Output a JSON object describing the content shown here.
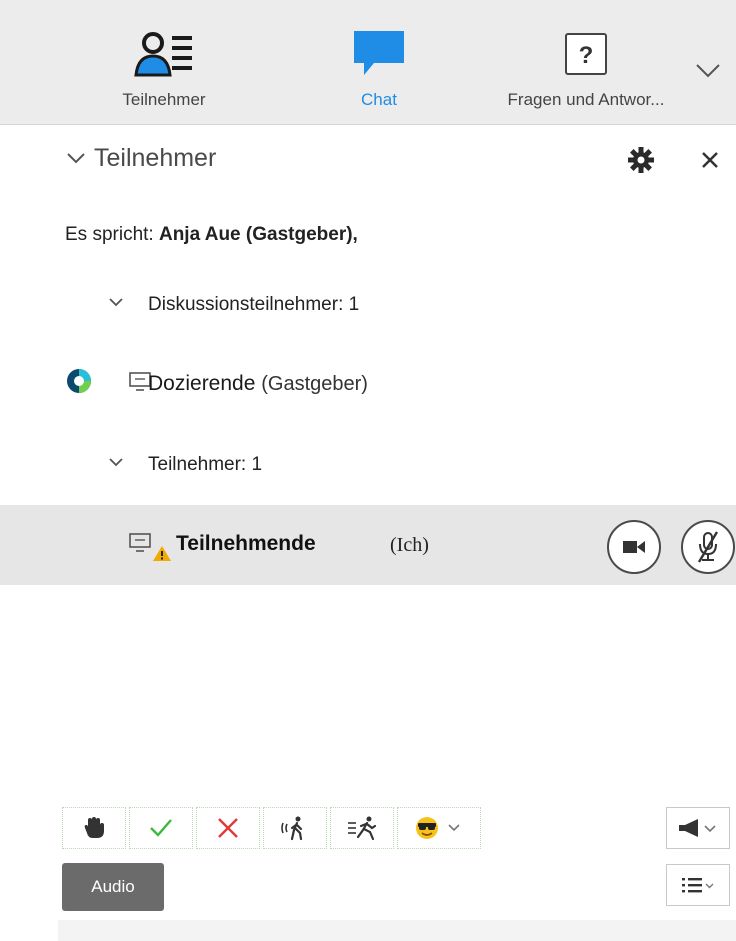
{
  "tabs": [
    {
      "label": "Teilnehmer",
      "icon": "participants-icon",
      "active": false
    },
    {
      "label": "Chat",
      "icon": "chat-icon",
      "active": true
    },
    {
      "label": "Fragen und Antwor...",
      "icon": "question-icon",
      "active": false
    }
  ],
  "panel": {
    "title": "Teilnehmer",
    "speaking_prefix": "Es spricht: ",
    "speaking_name": "Anja Aue (Gastgeber),"
  },
  "groups": {
    "panelists": "Diskussionsteilnehmer: 1",
    "attendees": "Teilnehmer: 1"
  },
  "host": {
    "name": "Dozierende",
    "role": "(Gastgeber)"
  },
  "me": {
    "name": "Teilnehmende",
    "self": "(Ich)"
  },
  "toolbar": {
    "audio_label": "Audio",
    "buttons": [
      "raise-hand-icon",
      "check-icon",
      "cross-icon",
      "walk-icon",
      "run-icon",
      "emoji-icon"
    ]
  },
  "colors": {
    "accent": "#1f8ce6",
    "topbar_bg": "#ececec",
    "selected_row": "#e6e6e6",
    "check": "#3cba3c",
    "cross": "#e03a3a",
    "warning": "#f2a900"
  }
}
